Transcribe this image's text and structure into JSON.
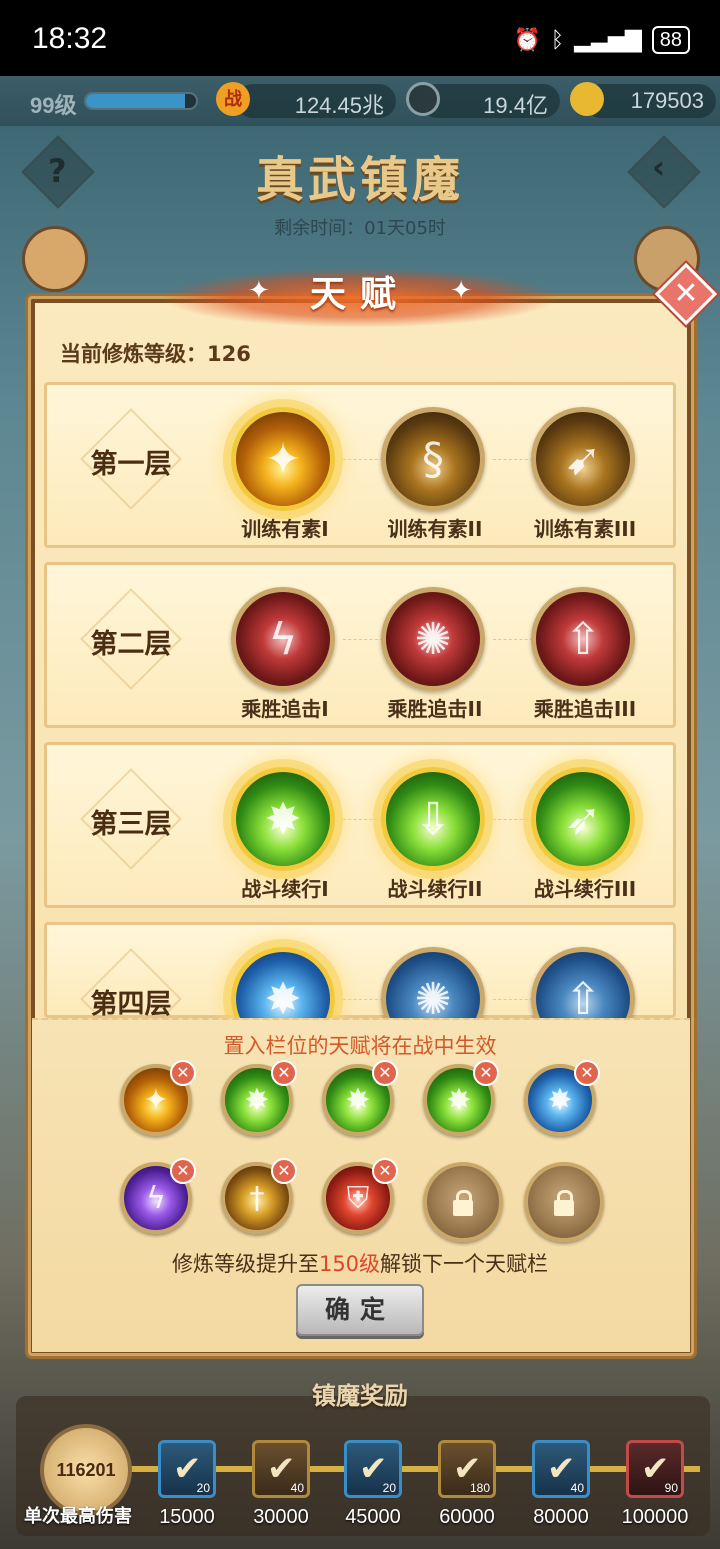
{
  "status_bar": {
    "time": "18:32",
    "battery": "88"
  },
  "resources": {
    "level": "99级",
    "level_progress": 0.9,
    "power_icon": "战",
    "power": "124.45兆",
    "coin": "19.4亿",
    "gold": "179503"
  },
  "event": {
    "title": "真武镇魔",
    "remaining": "剩余时间：01天05时"
  },
  "modal": {
    "title": "天赋",
    "current_level": "当前修炼等级：126",
    "tiers": [
      {
        "name": "第一层",
        "nodes": [
          {
            "label": "训练有素I",
            "icon": "fire-slash-icon",
            "active": true
          },
          {
            "label": "训练有素II",
            "icon": "fire-swirl-icon",
            "active": false
          },
          {
            "label": "训练有素III",
            "icon": "fire-arrow-icon",
            "active": false
          }
        ]
      },
      {
        "name": "第二层",
        "nodes": [
          {
            "label": "乘胜追击I",
            "icon": "red-lightning-icon",
            "active": false
          },
          {
            "label": "乘胜追击II",
            "icon": "red-vortex-icon",
            "active": false
          },
          {
            "label": "乘胜追击III",
            "icon": "red-arrow-icon",
            "active": false
          }
        ]
      },
      {
        "name": "第三层",
        "nodes": [
          {
            "label": "战斗续行I",
            "icon": "green-burst-icon",
            "active": true
          },
          {
            "label": "战斗续行II",
            "icon": "green-arrow-down-icon",
            "active": true
          },
          {
            "label": "战斗续行III",
            "icon": "green-slash-icon",
            "active": true
          }
        ]
      },
      {
        "name": "第四层",
        "nodes": [
          {
            "label": "",
            "icon": "blue-burst-icon",
            "active": true
          },
          {
            "label": "",
            "icon": "blue-vortex-icon",
            "active": false
          },
          {
            "label": "",
            "icon": "blue-arrow-icon",
            "active": false
          }
        ]
      }
    ],
    "slot_hint": "置入栏位的天赋将在战中生效",
    "unlock_prefix": "修炼等级提升至",
    "unlock_level": "150级",
    "unlock_suffix": "解锁下一个天赋栏",
    "confirm": "确定",
    "close_glyph": "✕"
  },
  "slots": [
    {
      "icon": "fire-slash-icon",
      "style": "fire"
    },
    {
      "icon": "green-burst-icon",
      "style": "green"
    },
    {
      "icon": "green-arrow-down-icon",
      "style": "green"
    },
    {
      "icon": "green-slash-icon",
      "style": "green"
    },
    {
      "icon": "blue-burst-icon",
      "style": "blue"
    },
    {
      "icon": "purple-burst-icon",
      "style": "purple"
    },
    {
      "icon": "golden-sword-icon",
      "style": "gold"
    },
    {
      "icon": "red-shield-icon",
      "style": "redshield"
    },
    {
      "icon": "lock-icon",
      "style": "locked"
    },
    {
      "icon": "lock-icon",
      "style": "locked"
    }
  ],
  "rewards": {
    "title": "镇魔奖励",
    "best_damage": "116201",
    "best_label": "单次最高伤害",
    "items": [
      {
        "count": "20",
        "value": "15000",
        "style": "blue"
      },
      {
        "count": "40",
        "value": "30000",
        "style": "gold"
      },
      {
        "count": "20",
        "value": "45000",
        "style": "blue"
      },
      {
        "count": "180",
        "value": "60000",
        "style": "gold"
      },
      {
        "count": "40",
        "value": "80000",
        "style": "blue"
      },
      {
        "count": "90",
        "value": "100000",
        "style": "redr"
      }
    ]
  }
}
